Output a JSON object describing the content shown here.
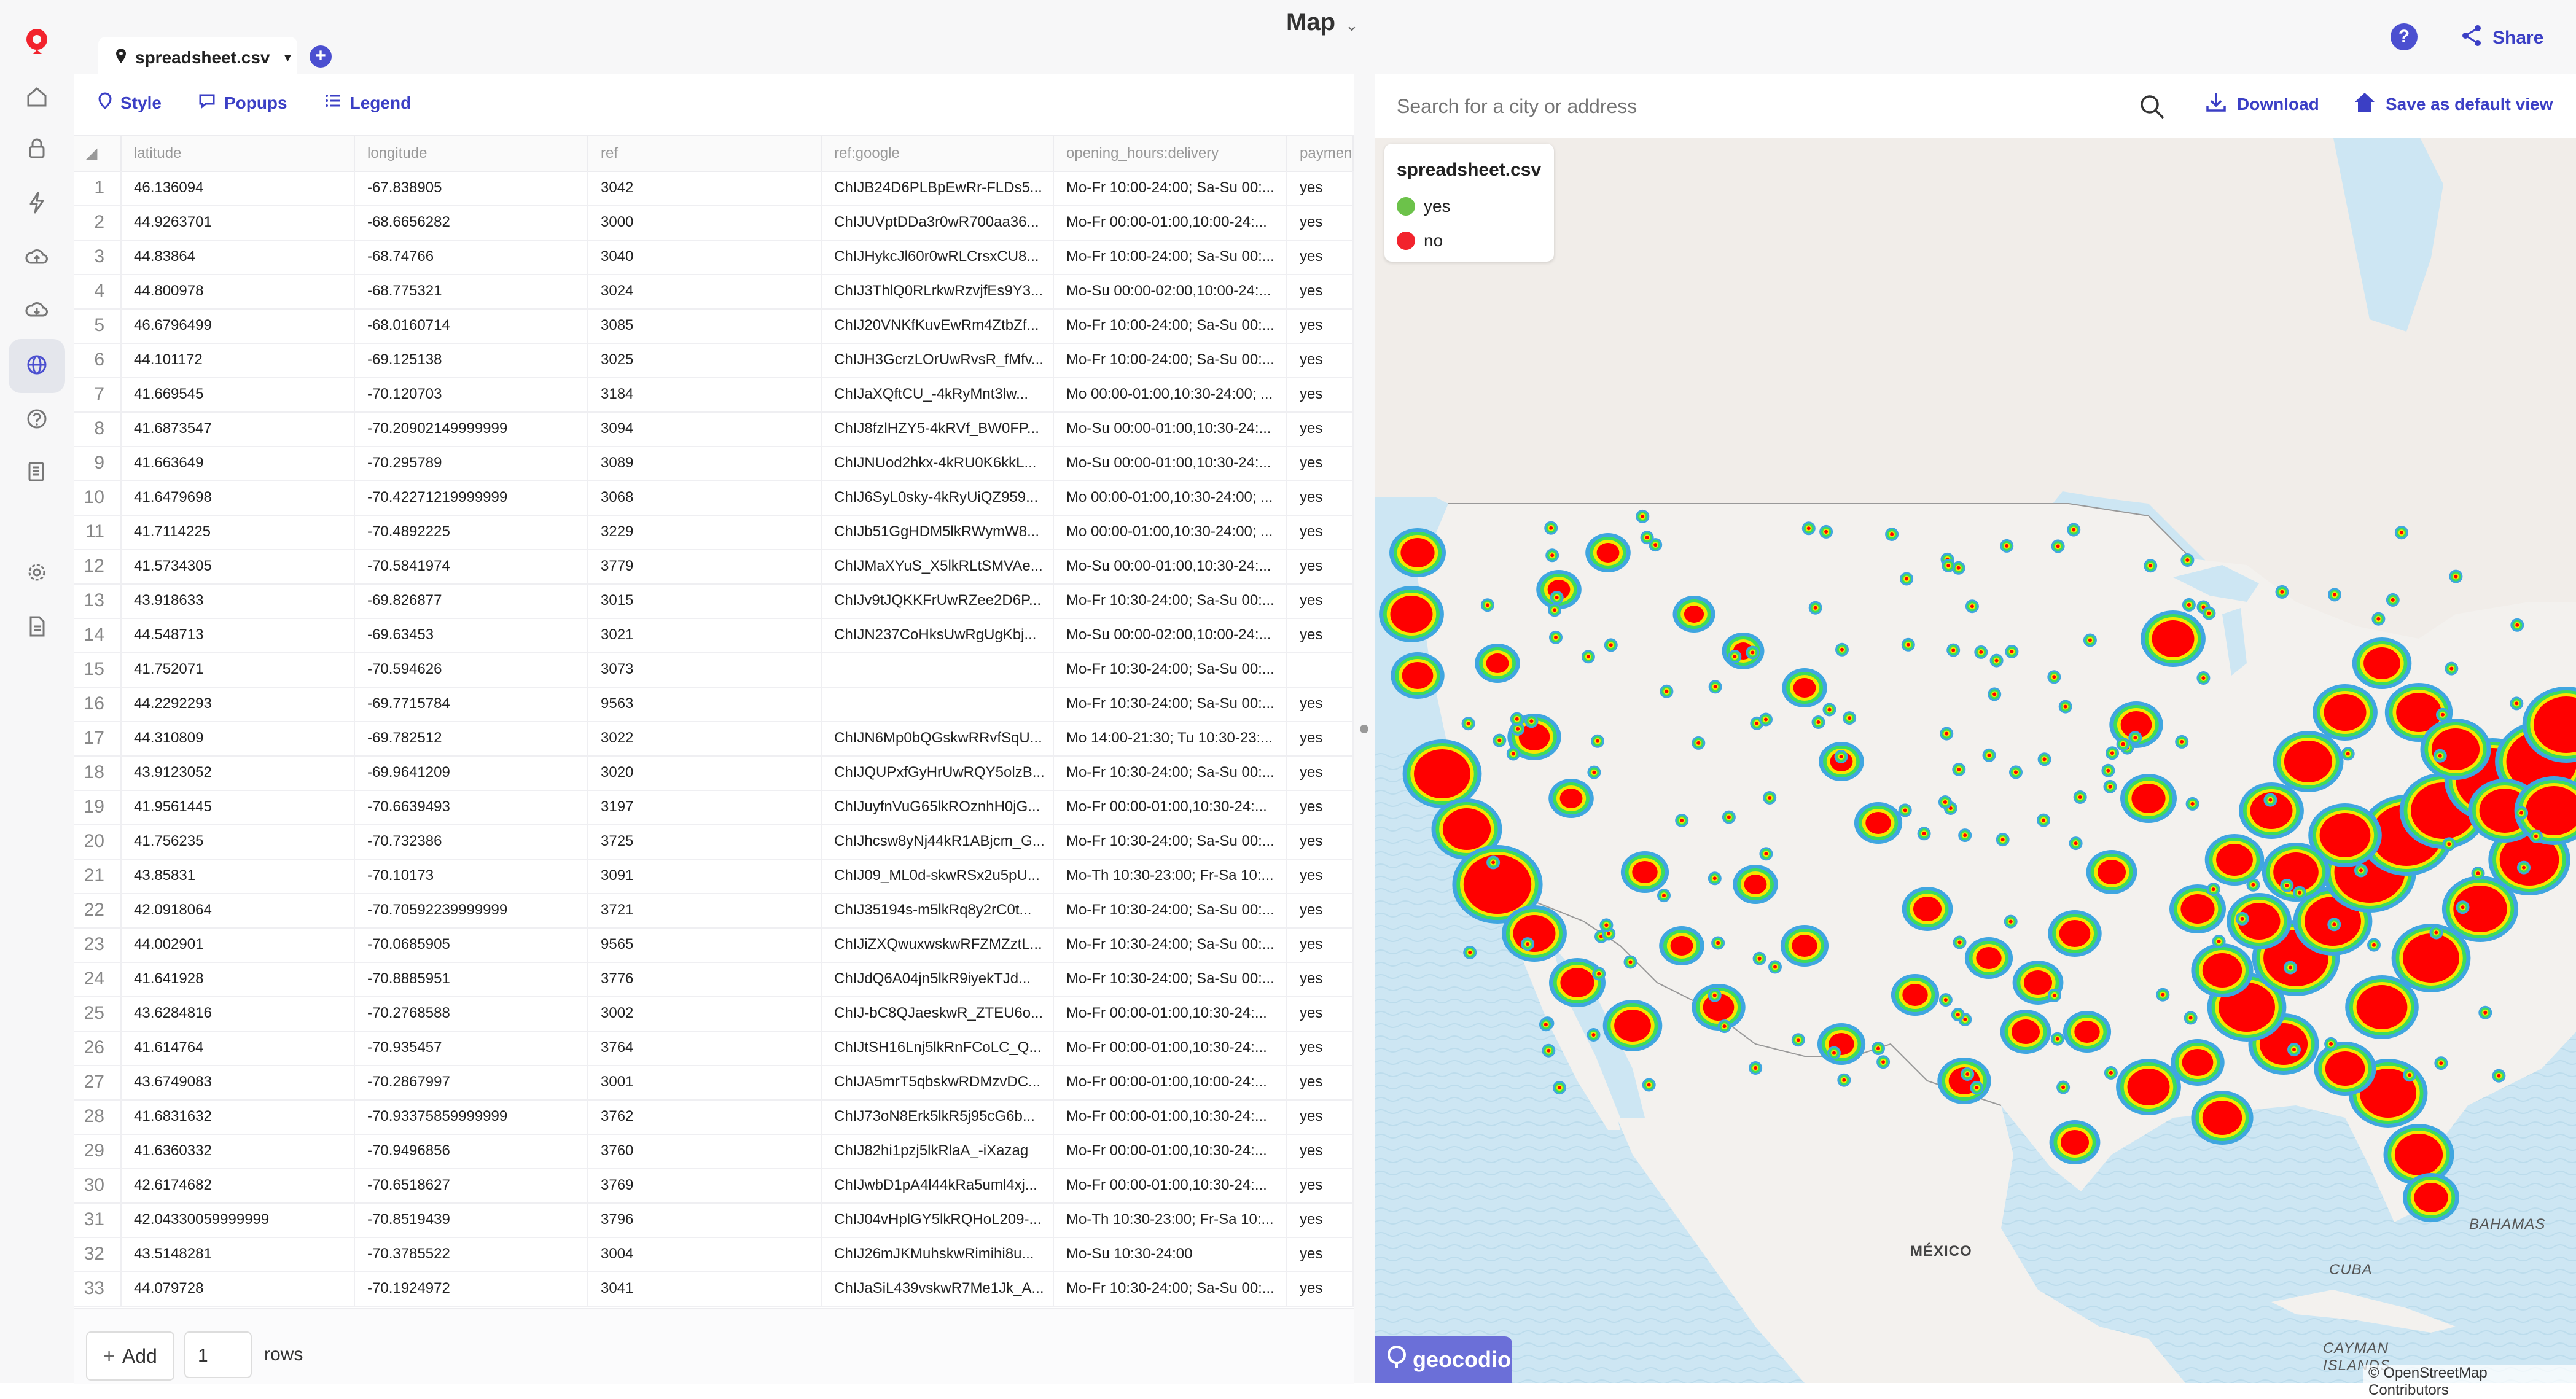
{
  "app": {
    "title": "Map",
    "share_label": "Share",
    "help_label": "?",
    "add_tab_label": "+"
  },
  "sidebar": {
    "icons": [
      "home-icon",
      "lock-icon",
      "bolt-icon",
      "cloud-upload-icon",
      "cloud-download-icon",
      "globe-icon",
      "help-circle-icon",
      "book-icon",
      "settings-icon",
      "document-icon"
    ],
    "active": "globe-icon"
  },
  "tab": {
    "name": "spreadsheet.csv"
  },
  "toolbar": {
    "style": "Style",
    "popups": "Popups",
    "legend": "Legend"
  },
  "columns": [
    "latitude",
    "longitude",
    "ref",
    "ref:google",
    "opening_hours:delivery",
    "paymen"
  ],
  "rows": [
    {
      "n": "1",
      "lat": "46.136094",
      "lon": "-67.838905",
      "ref": "3042",
      "google": "ChIJB24D6PLBpEwRr-FLDs5...",
      "hours": "Mo-Fr 10:00-24:00; Sa-Su 00:...",
      "pay": "yes"
    },
    {
      "n": "2",
      "lat": "44.9263701",
      "lon": "-68.6656282",
      "ref": "3000",
      "google": "ChIJUVptDDa3r0wR700aa36...",
      "hours": "Mo-Fr 00:00-01:00,10:00-24:...",
      "pay": "yes"
    },
    {
      "n": "3",
      "lat": "44.83864",
      "lon": "-68.74766",
      "ref": "3040",
      "google": "ChIJHykcJl60r0wRLCrsxCU8...",
      "hours": "Mo-Fr 10:00-24:00; Sa-Su 00:...",
      "pay": "yes"
    },
    {
      "n": "4",
      "lat": "44.800978",
      "lon": "-68.775321",
      "ref": "3024",
      "google": "ChIJ3ThlQ0RLrkwRzvjfEs9Y3...",
      "hours": "Mo-Su 00:00-02:00,10:00-24:...",
      "pay": "yes"
    },
    {
      "n": "5",
      "lat": "46.6796499",
      "lon": "-68.0160714",
      "ref": "3085",
      "google": "ChIJ20VNKfKuvEwRm4ZtbZf...",
      "hours": "Mo-Fr 10:00-24:00; Sa-Su 00:...",
      "pay": "yes"
    },
    {
      "n": "6",
      "lat": "44.101172",
      "lon": "-69.125138",
      "ref": "3025",
      "google": "ChIJH3GcrzLOrUwRvsR_fMfv...",
      "hours": "Mo-Fr 10:00-24:00; Sa-Su 00:...",
      "pay": "yes"
    },
    {
      "n": "7",
      "lat": "41.669545",
      "lon": "-70.120703",
      "ref": "3184",
      "google": "ChIJaXQftCU_-4kRyMnt3lw...",
      "hours": "Mo 00:00-01:00,10:30-24:00; ...",
      "pay": "yes"
    },
    {
      "n": "8",
      "lat": "41.6873547",
      "lon": "-70.20902149999999",
      "ref": "3094",
      "google": "ChIJ8fzlHZY5-4kRVf_BW0FP...",
      "hours": "Mo-Su 00:00-01:00,10:30-24:...",
      "pay": "yes"
    },
    {
      "n": "9",
      "lat": "41.663649",
      "lon": "-70.295789",
      "ref": "3089",
      "google": "ChIJNUod2hkx-4kRU0K6kkL...",
      "hours": "Mo-Su 00:00-01:00,10:30-24:...",
      "pay": "yes"
    },
    {
      "n": "10",
      "lat": "41.6479698",
      "lon": "-70.42271219999999",
      "ref": "3068",
      "google": "ChIJ6SyL0sky-4kRyUiQZ959...",
      "hours": "Mo 00:00-01:00,10:30-24:00; ...",
      "pay": "yes"
    },
    {
      "n": "11",
      "lat": "41.7114225",
      "lon": "-70.4892225",
      "ref": "3229",
      "google": "ChIJb51GgHDM5lkRWymW8...",
      "hours": "Mo 00:00-01:00,10:30-24:00; ...",
      "pay": "yes"
    },
    {
      "n": "12",
      "lat": "41.5734305",
      "lon": "-70.5841974",
      "ref": "3779",
      "google": "ChIJMaXYuS_X5lkRLtSMVAe...",
      "hours": "Mo-Su 00:00-01:00,10:30-24:...",
      "pay": "yes"
    },
    {
      "n": "13",
      "lat": "43.918633",
      "lon": "-69.826877",
      "ref": "3015",
      "google": "ChIJv9tJQKKFrUwRZee2D6P...",
      "hours": "Mo-Fr 10:30-24:00; Sa-Su 00:...",
      "pay": "yes"
    },
    {
      "n": "14",
      "lat": "44.548713",
      "lon": "-69.63453",
      "ref": "3021",
      "google": "ChIJN237CoHksUwRgUgKbj...",
      "hours": "Mo-Su 00:00-02:00,10:00-24:...",
      "pay": "yes"
    },
    {
      "n": "15",
      "lat": "41.752071",
      "lon": "-70.594626",
      "ref": "3073",
      "google": "",
      "hours": "Mo-Fr 10:30-24:00; Sa-Su 00:...",
      "pay": ""
    },
    {
      "n": "16",
      "lat": "44.2292293",
      "lon": "-69.7715784",
      "ref": "9563",
      "google": "",
      "hours": "Mo-Fr 10:30-24:00; Sa-Su 00:...",
      "pay": "yes"
    },
    {
      "n": "17",
      "lat": "44.310809",
      "lon": "-69.782512",
      "ref": "3022",
      "google": "ChIJN6Mp0bQGskwRRvfSqU...",
      "hours": "Mo 14:00-21:30; Tu 10:30-23:...",
      "pay": "yes"
    },
    {
      "n": "18",
      "lat": "43.9123052",
      "lon": "-69.9641209",
      "ref": "3020",
      "google": "ChIJQUPxfGyHrUwRQY5olzB...",
      "hours": "Mo-Fr 10:30-24:00; Sa-Su 00:...",
      "pay": "yes"
    },
    {
      "n": "19",
      "lat": "41.9561445",
      "lon": "-70.6639493",
      "ref": "3197",
      "google": "ChIJuyfnVuG65lkROznhH0jG...",
      "hours": "Mo-Fr 00:00-01:00,10:30-24:...",
      "pay": "yes"
    },
    {
      "n": "20",
      "lat": "41.756235",
      "lon": "-70.732386",
      "ref": "3725",
      "google": "ChIJhcsw8yNj44kR1ABjcm_G...",
      "hours": "Mo-Fr 10:30-24:00; Sa-Su 00:...",
      "pay": "yes"
    },
    {
      "n": "21",
      "lat": "43.85831",
      "lon": "-70.10173",
      "ref": "3091",
      "google": "ChIJ09_ML0d-skwRSx2u5pU...",
      "hours": "Mo-Th 10:30-23:00; Fr-Sa 10:...",
      "pay": "yes"
    },
    {
      "n": "22",
      "lat": "42.0918064",
      "lon": "-70.70592239999999",
      "ref": "3721",
      "google": "ChIJ35194s-m5lkRq8y2rC0t...",
      "hours": "Mo-Fr 10:30-24:00; Sa-Su 00:...",
      "pay": "yes"
    },
    {
      "n": "23",
      "lat": "44.002901",
      "lon": "-70.0685905",
      "ref": "9565",
      "google": "ChIJiZXQwuxwskwRFZMZztL...",
      "hours": "Mo-Fr 10:30-24:00; Sa-Su 00:...",
      "pay": "yes"
    },
    {
      "n": "24",
      "lat": "41.641928",
      "lon": "-70.8885951",
      "ref": "3776",
      "google": "ChIJdQ6A04jn5lkR9iyekTJd...",
      "hours": "Mo-Fr 10:30-24:00; Sa-Su 00:...",
      "pay": "yes"
    },
    {
      "n": "25",
      "lat": "43.6284816",
      "lon": "-70.2768588",
      "ref": "3002",
      "google": "ChIJ-bC8QJaeskwR_ZTEU6o...",
      "hours": "Mo-Fr 00:00-01:00,10:30-24:...",
      "pay": "yes"
    },
    {
      "n": "26",
      "lat": "41.614764",
      "lon": "-70.935457",
      "ref": "3764",
      "google": "ChIJtSH16Lnj5lkRnFCoLC_Q...",
      "hours": "Mo-Fr 00:00-01:00,10:30-24:...",
      "pay": "yes"
    },
    {
      "n": "27",
      "lat": "43.6749083",
      "lon": "-70.2867997",
      "ref": "3001",
      "google": "ChIJA5mrT5qbskwRDMzvDC...",
      "hours": "Mo-Fr 00:00-01:00,10:00-24:...",
      "pay": "yes"
    },
    {
      "n": "28",
      "lat": "41.6831632",
      "lon": "-70.93375859999999",
      "ref": "3762",
      "google": "ChIJ73oN8Erk5lkR5j95cG6b...",
      "hours": "Mo-Fr 00:00-01:00,10:30-24:...",
      "pay": "yes"
    },
    {
      "n": "29",
      "lat": "41.6360332",
      "lon": "-70.9496856",
      "ref": "3760",
      "google": "ChIJ82hi1pzj5lkRlaA_-iXazag",
      "hours": "Mo-Fr 00:00-01:00,10:30-24:...",
      "pay": "yes"
    },
    {
      "n": "30",
      "lat": "42.6174682",
      "lon": "-70.6518627",
      "ref": "3769",
      "google": "ChIJwbD1pA4l44kRa5uml4xj...",
      "hours": "Mo-Fr 00:00-01:00,10:30-24:...",
      "pay": "yes"
    },
    {
      "n": "31",
      "lat": "42.04330059999999",
      "lon": "-70.8519439",
      "ref": "3796",
      "google": "ChIJ04vHplGY5lkRQHoL209-...",
      "hours": "Mo-Th 10:30-23:00; Fr-Sa 10:...",
      "pay": "yes"
    },
    {
      "n": "32",
      "lat": "43.5148281",
      "lon": "-70.3785522",
      "ref": "3004",
      "google": "ChIJ26mJKMuhskwRimihi8u...",
      "hours": "Mo-Su 10:30-24:00",
      "pay": "yes"
    },
    {
      "n": "33",
      "lat": "44.079728",
      "lon": "-70.1924972",
      "ref": "3041",
      "google": "ChIJaSiL439vskwR7Me1Jk_A...",
      "hours": "Mo-Fr 10:30-24:00; Sa-Su 00:...",
      "pay": "yes"
    }
  ],
  "footer": {
    "add_label": "Add",
    "row_count": "1",
    "rows_label": "rows"
  },
  "map": {
    "search_placeholder": "Search for a city or address",
    "download_label": "Download",
    "save_default_label": "Save as default view",
    "legend_title": "spreadsheet.csv",
    "legend_items": [
      {
        "label": "yes",
        "color": "#6cc24a"
      },
      {
        "label": "no",
        "color": "#f2232d"
      }
    ],
    "labels": {
      "mexico": "MÉXICO",
      "bahamas": "BAHAMAS",
      "cuba": "CUBA",
      "cayman": "CAYMAN",
      "islands": "ISLANDS"
    },
    "attribution": "© OpenStreetMap Contributors",
    "brand": "geocodio"
  },
  "colors": {
    "accent": "#3b3fc5",
    "heat_core": "#ff0000",
    "heat_ring_yellow": "#f5e600",
    "heat_ring_green": "#3ddc5a",
    "heat_ring_blue": "#3fa6e0"
  }
}
